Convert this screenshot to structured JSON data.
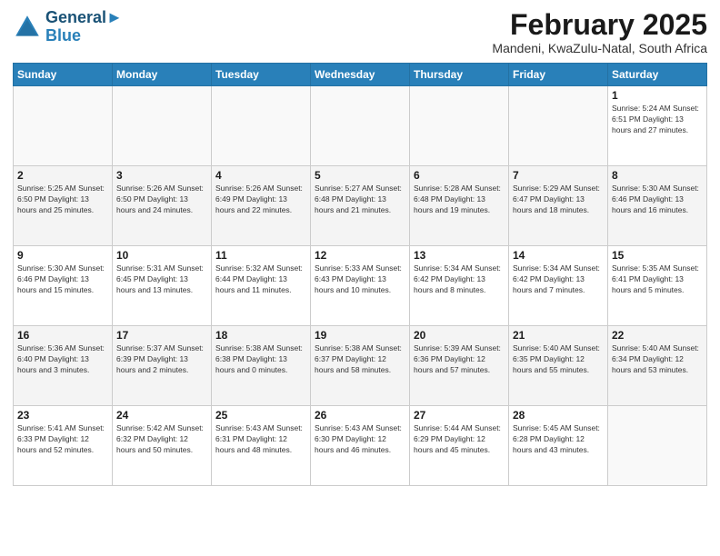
{
  "header": {
    "logo_line1": "General",
    "logo_line2": "Blue",
    "month_title": "February 2025",
    "location": "Mandeni, KwaZulu-Natal, South Africa"
  },
  "weekdays": [
    "Sunday",
    "Monday",
    "Tuesday",
    "Wednesday",
    "Thursday",
    "Friday",
    "Saturday"
  ],
  "weeks": [
    [
      {
        "day": "",
        "info": ""
      },
      {
        "day": "",
        "info": ""
      },
      {
        "day": "",
        "info": ""
      },
      {
        "day": "",
        "info": ""
      },
      {
        "day": "",
        "info": ""
      },
      {
        "day": "",
        "info": ""
      },
      {
        "day": "1",
        "info": "Sunrise: 5:24 AM\nSunset: 6:51 PM\nDaylight: 13 hours\nand 27 minutes."
      }
    ],
    [
      {
        "day": "2",
        "info": "Sunrise: 5:25 AM\nSunset: 6:50 PM\nDaylight: 13 hours\nand 25 minutes."
      },
      {
        "day": "3",
        "info": "Sunrise: 5:26 AM\nSunset: 6:50 PM\nDaylight: 13 hours\nand 24 minutes."
      },
      {
        "day": "4",
        "info": "Sunrise: 5:26 AM\nSunset: 6:49 PM\nDaylight: 13 hours\nand 22 minutes."
      },
      {
        "day": "5",
        "info": "Sunrise: 5:27 AM\nSunset: 6:48 PM\nDaylight: 13 hours\nand 21 minutes."
      },
      {
        "day": "6",
        "info": "Sunrise: 5:28 AM\nSunset: 6:48 PM\nDaylight: 13 hours\nand 19 minutes."
      },
      {
        "day": "7",
        "info": "Sunrise: 5:29 AM\nSunset: 6:47 PM\nDaylight: 13 hours\nand 18 minutes."
      },
      {
        "day": "8",
        "info": "Sunrise: 5:30 AM\nSunset: 6:46 PM\nDaylight: 13 hours\nand 16 minutes."
      }
    ],
    [
      {
        "day": "9",
        "info": "Sunrise: 5:30 AM\nSunset: 6:46 PM\nDaylight: 13 hours\nand 15 minutes."
      },
      {
        "day": "10",
        "info": "Sunrise: 5:31 AM\nSunset: 6:45 PM\nDaylight: 13 hours\nand 13 minutes."
      },
      {
        "day": "11",
        "info": "Sunrise: 5:32 AM\nSunset: 6:44 PM\nDaylight: 13 hours\nand 11 minutes."
      },
      {
        "day": "12",
        "info": "Sunrise: 5:33 AM\nSunset: 6:43 PM\nDaylight: 13 hours\nand 10 minutes."
      },
      {
        "day": "13",
        "info": "Sunrise: 5:34 AM\nSunset: 6:42 PM\nDaylight: 13 hours\nand 8 minutes."
      },
      {
        "day": "14",
        "info": "Sunrise: 5:34 AM\nSunset: 6:42 PM\nDaylight: 13 hours\nand 7 minutes."
      },
      {
        "day": "15",
        "info": "Sunrise: 5:35 AM\nSunset: 6:41 PM\nDaylight: 13 hours\nand 5 minutes."
      }
    ],
    [
      {
        "day": "16",
        "info": "Sunrise: 5:36 AM\nSunset: 6:40 PM\nDaylight: 13 hours\nand 3 minutes."
      },
      {
        "day": "17",
        "info": "Sunrise: 5:37 AM\nSunset: 6:39 PM\nDaylight: 13 hours\nand 2 minutes."
      },
      {
        "day": "18",
        "info": "Sunrise: 5:38 AM\nSunset: 6:38 PM\nDaylight: 13 hours\nand 0 minutes."
      },
      {
        "day": "19",
        "info": "Sunrise: 5:38 AM\nSunset: 6:37 PM\nDaylight: 12 hours\nand 58 minutes."
      },
      {
        "day": "20",
        "info": "Sunrise: 5:39 AM\nSunset: 6:36 PM\nDaylight: 12 hours\nand 57 minutes."
      },
      {
        "day": "21",
        "info": "Sunrise: 5:40 AM\nSunset: 6:35 PM\nDaylight: 12 hours\nand 55 minutes."
      },
      {
        "day": "22",
        "info": "Sunrise: 5:40 AM\nSunset: 6:34 PM\nDaylight: 12 hours\nand 53 minutes."
      }
    ],
    [
      {
        "day": "23",
        "info": "Sunrise: 5:41 AM\nSunset: 6:33 PM\nDaylight: 12 hours\nand 52 minutes."
      },
      {
        "day": "24",
        "info": "Sunrise: 5:42 AM\nSunset: 6:32 PM\nDaylight: 12 hours\nand 50 minutes."
      },
      {
        "day": "25",
        "info": "Sunrise: 5:43 AM\nSunset: 6:31 PM\nDaylight: 12 hours\nand 48 minutes."
      },
      {
        "day": "26",
        "info": "Sunrise: 5:43 AM\nSunset: 6:30 PM\nDaylight: 12 hours\nand 46 minutes."
      },
      {
        "day": "27",
        "info": "Sunrise: 5:44 AM\nSunset: 6:29 PM\nDaylight: 12 hours\nand 45 minutes."
      },
      {
        "day": "28",
        "info": "Sunrise: 5:45 AM\nSunset: 6:28 PM\nDaylight: 12 hours\nand 43 minutes."
      },
      {
        "day": "",
        "info": ""
      }
    ]
  ]
}
